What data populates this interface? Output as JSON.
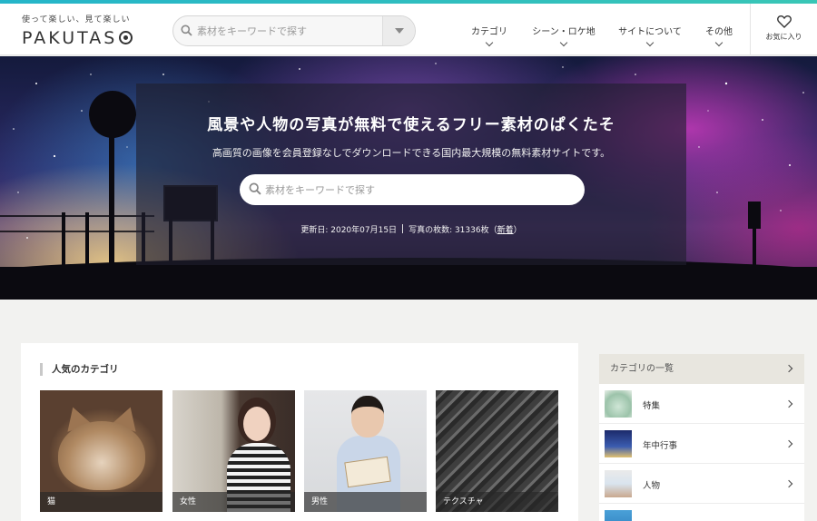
{
  "header": {
    "logo_tagline": "使って楽しい、見て楽しい",
    "logo_text": "PAKUTAS",
    "search_placeholder": "素材をキーワードで探す",
    "nav": [
      {
        "label": "カテゴリ"
      },
      {
        "label": "シーン・ロケ地"
      },
      {
        "label": "サイトについて"
      },
      {
        "label": "その他"
      }
    ],
    "favorites_label": "お気に入り"
  },
  "hero": {
    "title": "風景や人物の写真が無料で使えるフリー素材のぱくたそ",
    "subtitle": "高画質の画像を会員登録なしでダウンロードできる国内最大規模の無料素材サイトです。",
    "search_placeholder": "素材をキーワードで探す",
    "updated": "更新日: 2020年07月15日",
    "photo_count": "写真の枚数: 31336枚",
    "new_link": "新着"
  },
  "popular": {
    "title": "人気のカテゴリ",
    "items": [
      {
        "label": "猫"
      },
      {
        "label": "女性"
      },
      {
        "label": "男性"
      },
      {
        "label": "テクスチャ"
      }
    ]
  },
  "sidebar": {
    "title": "カテゴリの一覧",
    "items": [
      {
        "label": "特集"
      },
      {
        "label": "年中行事"
      },
      {
        "label": "人物"
      }
    ]
  }
}
